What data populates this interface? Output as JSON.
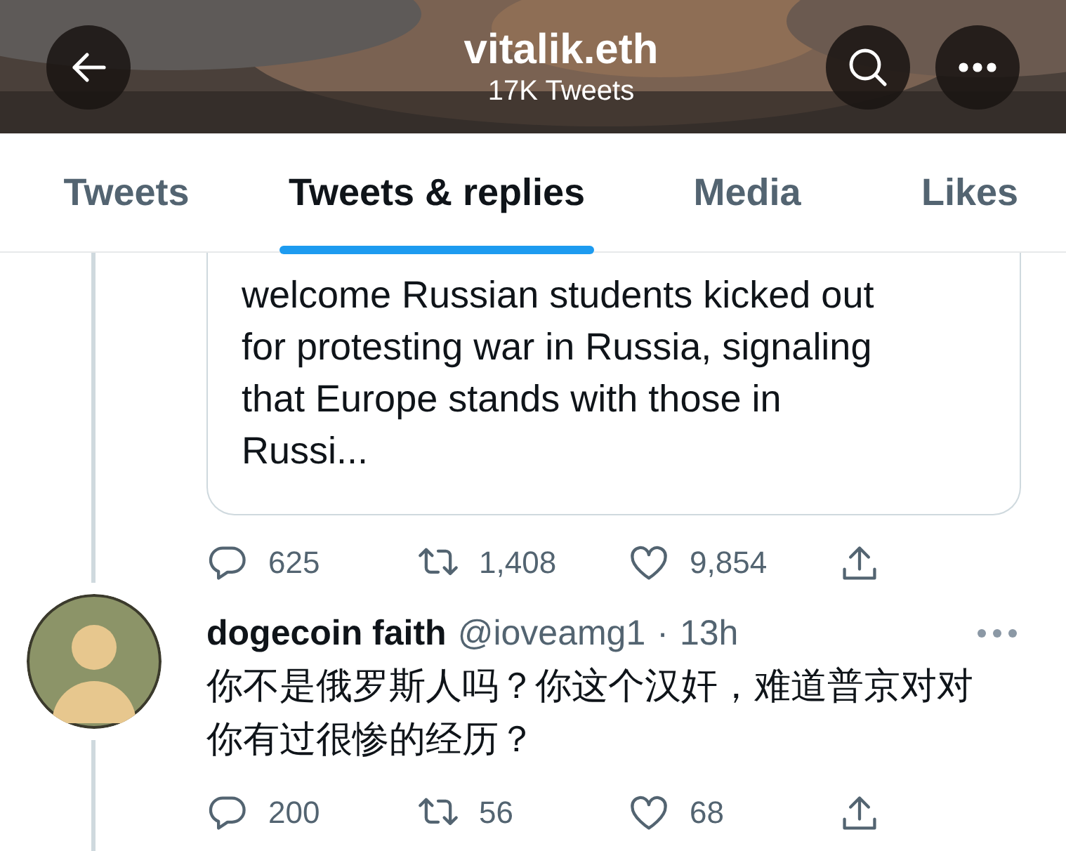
{
  "header": {
    "title": "vitalik.eth",
    "subtitle": "17K Tweets"
  },
  "tabs": [
    {
      "label": "Tweets",
      "selected": false
    },
    {
      "label": "Tweets & replies",
      "selected": true
    },
    {
      "label": "Media",
      "selected": false
    },
    {
      "label": "Likes",
      "selected": false
    }
  ],
  "timeline": [
    {
      "kind": "quote-tail",
      "quote_text": "welcome Russian students kicked out for protesting war in Russia, signaling that Europe stands with those in Russi...",
      "actions": [
        {
          "kind": "reply",
          "count": "625"
        },
        {
          "kind": "retweet",
          "count": "1,408"
        },
        {
          "kind": "like",
          "count": "9,854"
        },
        {
          "kind": "share"
        }
      ]
    },
    {
      "kind": "tweet",
      "name": "dogecoin faith",
      "handle": "@ioveamg1",
      "separator": "·",
      "time": "13h",
      "text": "你不是俄罗斯人吗？你这个汉奸，难道普京对对你有过很惨的经历？",
      "actions": [
        {
          "kind": "reply",
          "count": "200"
        },
        {
          "kind": "retweet",
          "count": "56"
        },
        {
          "kind": "like",
          "count": "68"
        },
        {
          "kind": "share"
        }
      ]
    }
  ]
}
